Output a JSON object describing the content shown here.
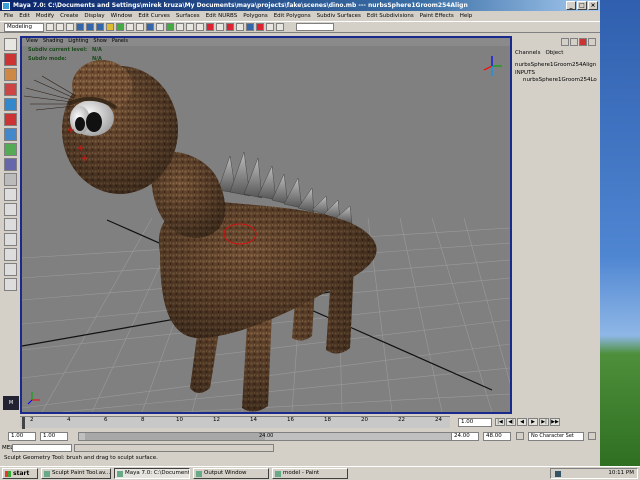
{
  "window": {
    "title": "Maya 7.0: C:\\Documents and Settings\\mirek kruza\\My Documents\\maya\\projects\\fake\\scenes\\dino.mb  ---  nurbsSphere1Groom254Align"
  },
  "menubar": {
    "items": [
      "File",
      "Edit",
      "Modify",
      "Create",
      "Display",
      "Window",
      "Edit Curves",
      "Surfaces",
      "Edit NURBS",
      "Polygons",
      "Edit Polygons",
      "Subdiv Surfaces",
      "Edit Subdivisions",
      "Paint Effects",
      "Help"
    ]
  },
  "shelf": {
    "mode": "Modeling",
    "sel_label": "",
    "sel_value": ""
  },
  "viewport": {
    "panel_menu": [
      "View",
      "Shading",
      "Lighting",
      "Show",
      "Panels"
    ],
    "hud": [
      {
        "label": "Subdiv current level:",
        "value": "N/A"
      },
      {
        "label": "Subdiv mode:",
        "value": "N/A"
      }
    ]
  },
  "channelbox": {
    "tabs": [
      "Channels",
      "Object"
    ],
    "object_name": "nurbsSphere1Groom254Align",
    "inputs_label": "INPUTS",
    "inputs": [
      "nurbsSphere1Groom254Lo"
    ]
  },
  "timeslider": {
    "ticks": [
      "2",
      "4",
      "6",
      "8",
      "10",
      "12",
      "14",
      "16",
      "18",
      "20",
      "22",
      "24"
    ],
    "current_frame": "1.00"
  },
  "rangeslider": {
    "start": "1.00",
    "playback_start": "1.00",
    "bar_label": "24.00",
    "end": "24.00",
    "playback_end": "48.00",
    "character_set": "No Character Set"
  },
  "playback": {
    "buttons": [
      "|◀",
      "◀|",
      "◀",
      "▶",
      "▶|",
      "▶▶"
    ]
  },
  "cmdline": {
    "label": "MEL"
  },
  "helpline": {
    "text": "Sculpt Geometry Tool: brush and drag to sculpt surface."
  },
  "taskbar": {
    "start_label": "start",
    "tasks": [
      "Sculpt Paint Tool.av...",
      "Maya 7.0: C:\\Documents...",
      "Output Window",
      "model - Paint"
    ],
    "active_task_index": 1,
    "clock": "10:11 PM"
  },
  "colors": {
    "title_bar": "#0a246a",
    "viewport_bg": "#808080",
    "viewport_border": "#1a2a8c",
    "fur": "#6b4a30"
  }
}
